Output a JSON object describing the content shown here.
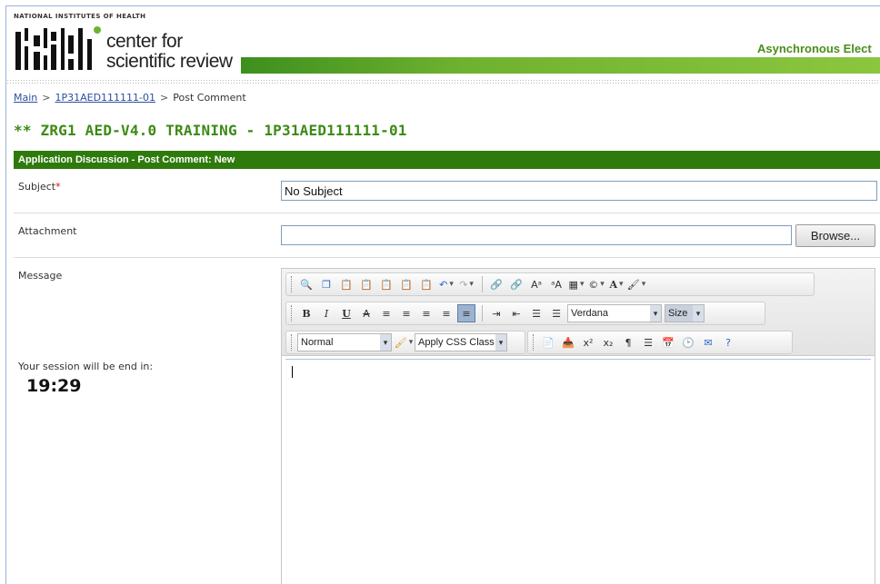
{
  "header": {
    "org": "NATIONAL INSTITUTES OF HEALTH",
    "logo_line1": "center for",
    "logo_line2": "scientific review",
    "app_title": "Asynchronous Elect"
  },
  "breadcrumb": {
    "main": "Main",
    "separator": ">",
    "application": "1P31AED111111-01",
    "current": "Post Comment"
  },
  "page_title": "** ZRG1 AED-V4.0 TRAINING - 1P31AED111111-01",
  "section_title": "Application Discussion - Post Comment: New",
  "form": {
    "subject_label": "Subject",
    "subject_required": "*",
    "subject_value": "No Subject",
    "attachment_label": "Attachment",
    "attachment_value": "",
    "browse_label": "Browse...",
    "message_label": "Message"
  },
  "session": {
    "label": "Your session will be end in:",
    "time": "19:29"
  },
  "editor": {
    "font_value": "Verdana",
    "size_value": "Size",
    "format_value": "Normal",
    "css_class_value": "Apply CSS Class"
  },
  "colors": {
    "brand_green": "#2f7a0c",
    "title_green": "#3d8a15",
    "link_blue": "#2c4fa0"
  }
}
